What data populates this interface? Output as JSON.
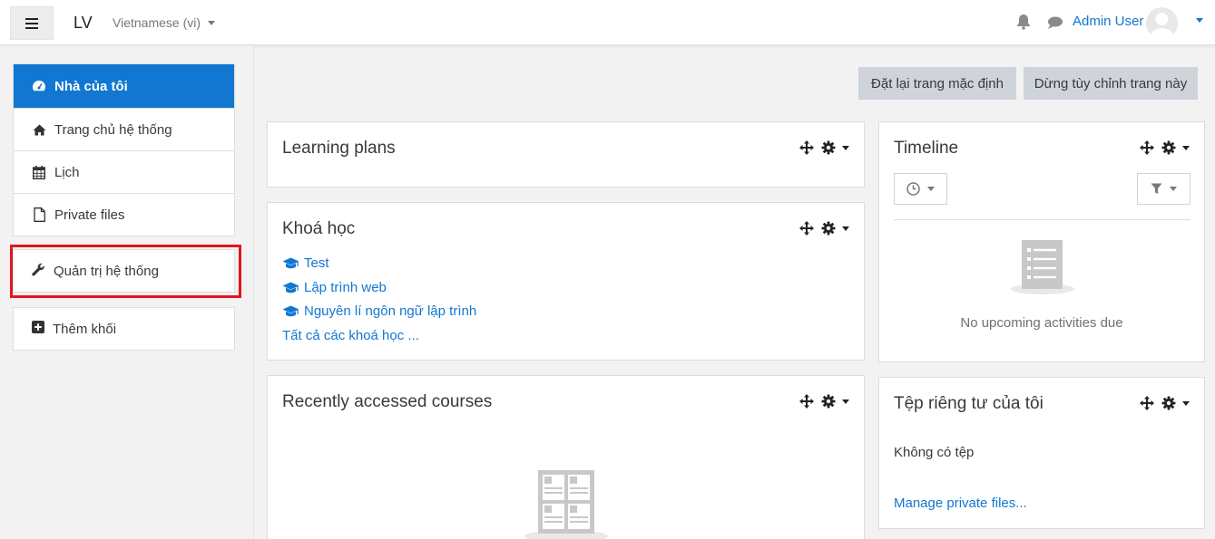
{
  "header": {
    "brand": "LV",
    "language": "Vietnamese (vi)",
    "username": "Admin User"
  },
  "drawer": {
    "items": [
      {
        "label": "Nhà của tôi",
        "icon": "dashboard-icon"
      },
      {
        "label": "Trang chủ hệ thống",
        "icon": "home-icon"
      },
      {
        "label": "Lịch",
        "icon": "calendar-icon"
      },
      {
        "label": "Private files",
        "icon": "file-icon"
      }
    ],
    "admin": {
      "label": "Quản trị hệ thống",
      "icon": "wrench-icon"
    },
    "add_block": {
      "label": "Thêm khối",
      "icon": "plus-square-icon"
    }
  },
  "actions": {
    "reset_label": "Đặt lại trang mặc định",
    "stop_label": "Dừng tùy chỉnh trang này"
  },
  "blocks": {
    "learning_plans": {
      "title": "Learning plans"
    },
    "courses": {
      "title": "Khoá học",
      "items": [
        "Test",
        "Lập trình web",
        "Nguyên lí ngôn ngữ lập trình"
      ],
      "all_link": "Tất cả các khoá học ..."
    },
    "recent": {
      "title": "Recently accessed courses"
    },
    "timeline": {
      "title": "Timeline",
      "empty": "No upcoming activities due"
    },
    "private_files": {
      "title": "Tệp riêng tư của tôi",
      "empty": "Không có tệp",
      "manage": "Manage private files..."
    }
  },
  "colors": {
    "accent": "#1177d1",
    "highlight": "#e0161b",
    "button_bg": "#ced4da",
    "page_bg": "#f2f2f2"
  }
}
